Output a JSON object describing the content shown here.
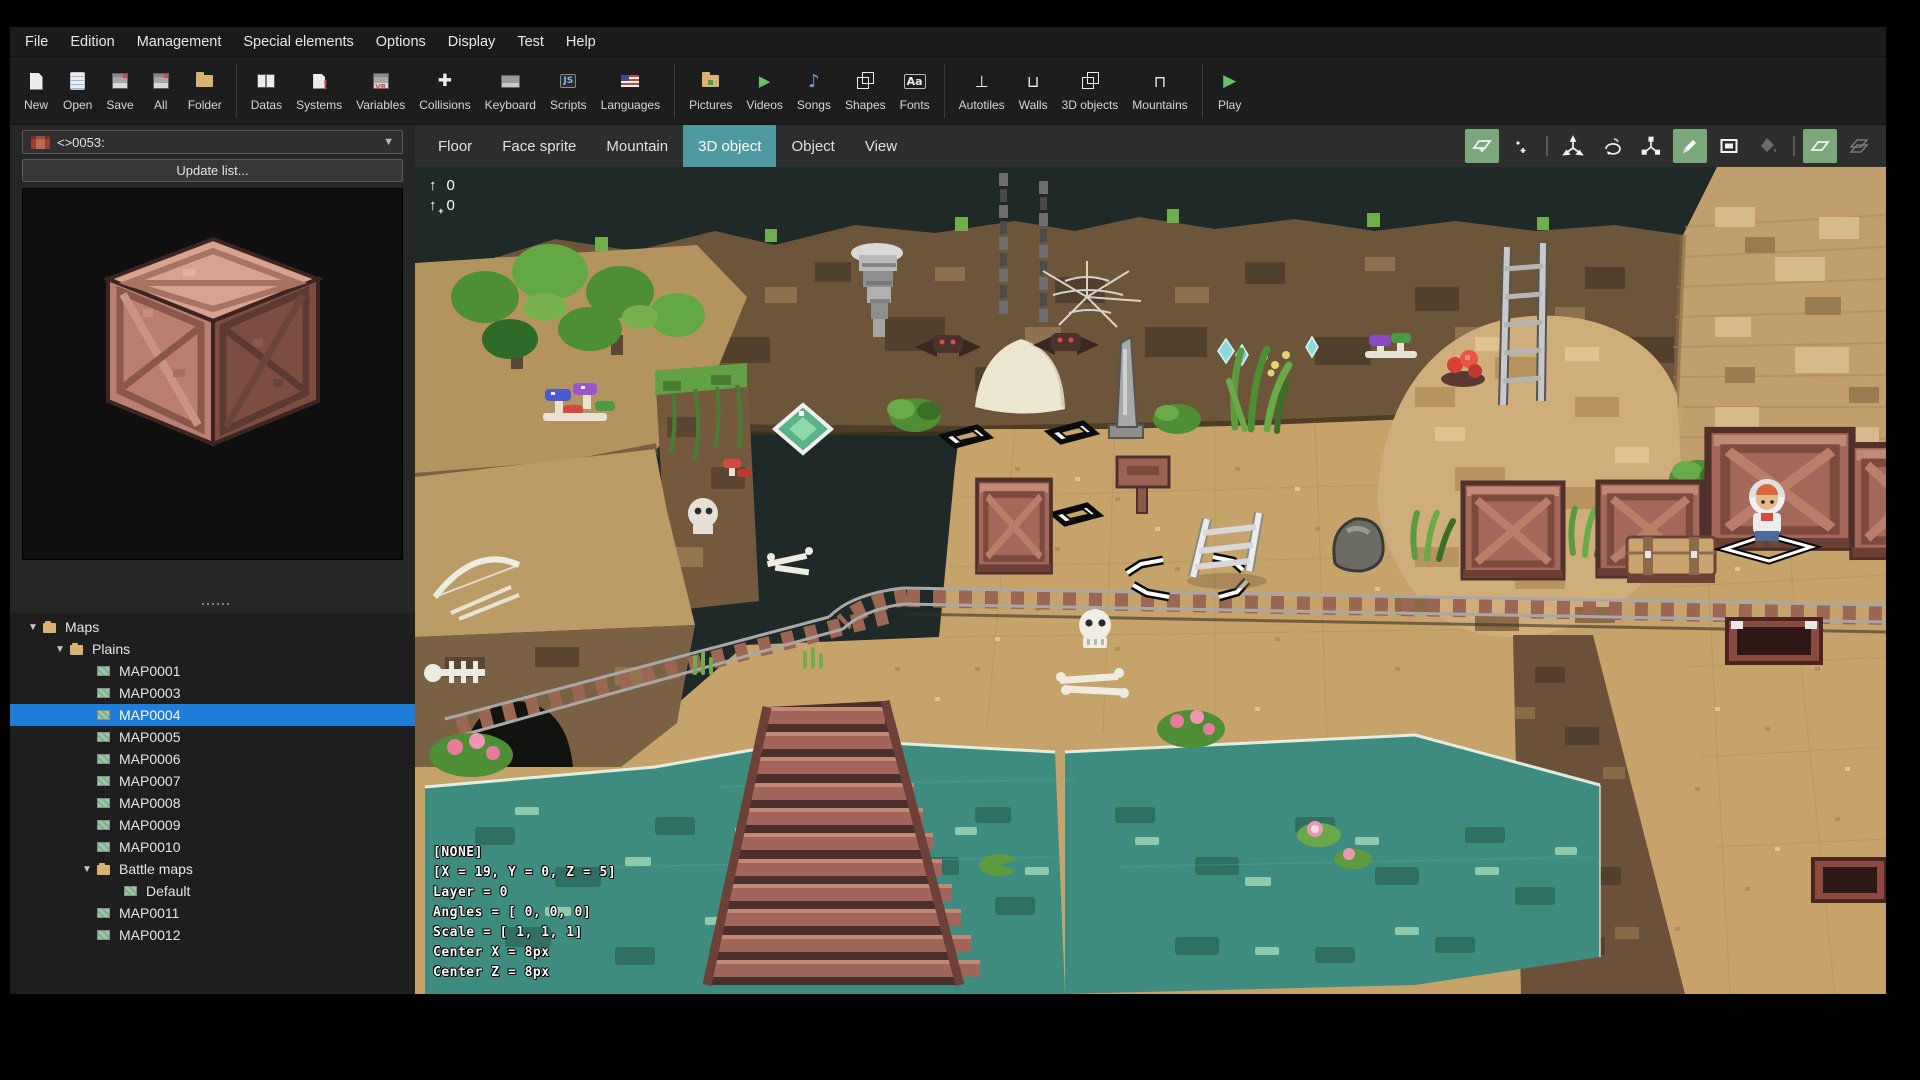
{
  "menu": {
    "items": [
      "File",
      "Edition",
      "Management",
      "Special elements",
      "Options",
      "Display",
      "Test",
      "Help"
    ]
  },
  "toolbar": {
    "items": [
      {
        "icon": "new-page",
        "label": "New"
      },
      {
        "icon": "open-clipboard",
        "label": "Open"
      },
      {
        "icon": "save-floppy",
        "label": "Save"
      },
      {
        "icon": "save-all-floppy",
        "label": "All"
      },
      {
        "icon": "folder",
        "label": "Folder",
        "sep_after": true
      },
      {
        "icon": "datas-book",
        "label": "Datas"
      },
      {
        "icon": "systems-page",
        "label": "Systems"
      },
      {
        "icon": "variables-floppy",
        "label": "Variables"
      },
      {
        "icon": "collisions-cross",
        "label": "Collisions"
      },
      {
        "icon": "keyboard",
        "label": "Keyboard"
      },
      {
        "icon": "scripts-js",
        "label": "Scripts"
      },
      {
        "icon": "languages-flag",
        "label": "Languages",
        "sep_after": true
      },
      {
        "icon": "pictures-folder",
        "label": "Pictures"
      },
      {
        "icon": "videos-play",
        "label": "Videos"
      },
      {
        "icon": "songs-note",
        "label": "Songs"
      },
      {
        "icon": "shapes-cube",
        "label": "Shapes"
      },
      {
        "icon": "fonts-aa",
        "label": "Fonts",
        "sep_after": true
      },
      {
        "icon": "autotiles",
        "label": "Autotiles"
      },
      {
        "icon": "walls",
        "label": "Walls"
      },
      {
        "icon": "objects-3d",
        "label": "3D objects"
      },
      {
        "icon": "mountains",
        "label": "Mountains",
        "sep_after": true
      },
      {
        "icon": "play",
        "label": "Play"
      }
    ]
  },
  "left_panel": {
    "object_selector": {
      "icon": "crate-texture",
      "value": "<>0053:"
    },
    "update_button": "Update list...",
    "tree": [
      {
        "depth": 0,
        "type": "folder",
        "arrow": true,
        "label": "Maps"
      },
      {
        "depth": 1,
        "type": "folder",
        "arrow": true,
        "label": "Plains"
      },
      {
        "depth": 2,
        "type": "map",
        "label": "MAP0001"
      },
      {
        "depth": 2,
        "type": "map",
        "label": "MAP0003"
      },
      {
        "depth": 2,
        "type": "map",
        "label": "MAP0004",
        "selected": true
      },
      {
        "depth": 2,
        "type": "map",
        "label": "MAP0005"
      },
      {
        "depth": 2,
        "type": "map",
        "label": "MAP0006"
      },
      {
        "depth": 2,
        "type": "map",
        "label": "MAP0007"
      },
      {
        "depth": 2,
        "type": "map",
        "label": "MAP0008"
      },
      {
        "depth": 2,
        "type": "map",
        "label": "MAP0009"
      },
      {
        "depth": 2,
        "type": "map",
        "label": "MAP0010"
      },
      {
        "depth": 2,
        "type": "folder",
        "arrow": true,
        "label": "Battle maps"
      },
      {
        "depth": 3,
        "type": "map",
        "label": "Default"
      },
      {
        "depth": 2,
        "type": "map",
        "label": "MAP0011"
      },
      {
        "depth": 2,
        "type": "map",
        "label": "MAP0012"
      }
    ]
  },
  "editor": {
    "tabs": [
      {
        "label": "Floor"
      },
      {
        "label": "Face sprite"
      },
      {
        "label": "Mountain"
      },
      {
        "label": "3D object",
        "selected": true
      },
      {
        "label": "Object"
      },
      {
        "label": "View"
      }
    ],
    "tools": [
      {
        "name": "translate-plane",
        "active": true
      },
      {
        "name": "pin-point"
      },
      {
        "name": "move-axes"
      },
      {
        "name": "rotate-axes"
      },
      {
        "name": "scale-axes"
      },
      {
        "name": "pencil",
        "active": true
      },
      {
        "name": "rectangle"
      },
      {
        "name": "paint-bucket",
        "disabled": true
      },
      {
        "name": "layer-plane",
        "active": true
      },
      {
        "name": "layers-stack",
        "disabled": true
      }
    ],
    "height_indicators": [
      {
        "icon": "arrow-up",
        "value": "0"
      },
      {
        "icon": "arrow-up-plus",
        "value": "0"
      }
    ],
    "cursor_overlay": {
      "lines": [
        "[NONE]",
        "[X = 19, Y = 0, Z = 5]",
        "Layer = 0",
        "Angles = [ 0, 0, 0]",
        "Scale = [ 1, 1, 1]",
        "Center X = 8px",
        "Center Z = 8px"
      ]
    }
  },
  "colors": {
    "accent_teal": "#4f99a1",
    "accent_green": "#7aa87b",
    "selection_blue": "#1d7dd8",
    "sand": "#c6a36b",
    "water": "#3e8b7f",
    "cliff": "#6d5539",
    "viewport_bg": "#1e2928"
  }
}
